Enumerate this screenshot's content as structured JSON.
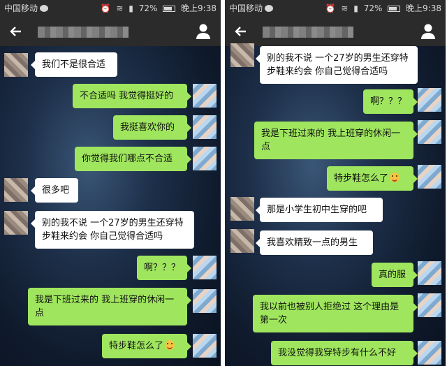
{
  "status_bar": {
    "carrier": "中国移动",
    "battery": "72%",
    "time": "晚上9:38",
    "icons": [
      "wechat-icon",
      "alarm-icon",
      "wifi-icon",
      "signal-icon",
      "battery-icon"
    ]
  },
  "titlebar": {
    "icons": [
      "back-arrow-icon",
      "profile-icon"
    ]
  },
  "colors": {
    "bar": "#2b2b2b",
    "bubble_me": "#9fe65e",
    "bubble_friend": "#ffffff"
  },
  "left_messages": [
    {
      "from": "friend",
      "text": "我们不是很合适"
    },
    {
      "from": "me",
      "text": "不合适吗 我觉得挺好的"
    },
    {
      "from": "me",
      "text": "我挺喜欢你的"
    },
    {
      "from": "me",
      "text": "你觉得我们哪点不合适"
    },
    {
      "from": "friend",
      "text": "很多吧"
    },
    {
      "from": "friend",
      "text": "别的我不说 一个27岁的男生还穿特步鞋来约会 你自己觉得合适吗"
    },
    {
      "from": "me",
      "text": "啊？？？"
    },
    {
      "from": "me",
      "text": "我是下班过来的 我上班穿的休闲一点"
    },
    {
      "from": "me",
      "text": "特步鞋怎么了",
      "emoji": "smile-emoji-icon"
    }
  ],
  "right_messages": [
    {
      "from": "friend",
      "text": "别的我不说 一个27岁的男生还穿特步鞋来约会 你自己觉得合适吗"
    },
    {
      "from": "me",
      "text": "啊？？？"
    },
    {
      "from": "me",
      "text": "我是下班过来的 我上班穿的休闲一点"
    },
    {
      "from": "me",
      "text": "特步鞋怎么了",
      "emoji": "smile-emoji-icon"
    },
    {
      "from": "friend",
      "text": "那是小学生初中生穿的吧"
    },
    {
      "from": "friend",
      "text": "我喜欢精致一点的男生"
    },
    {
      "from": "me",
      "text": "真的服"
    },
    {
      "from": "me",
      "text": "我以前也被别人拒绝过 这个理由是第一次"
    },
    {
      "from": "me",
      "text": "我没觉得我穿特步有什么不好"
    }
  ]
}
